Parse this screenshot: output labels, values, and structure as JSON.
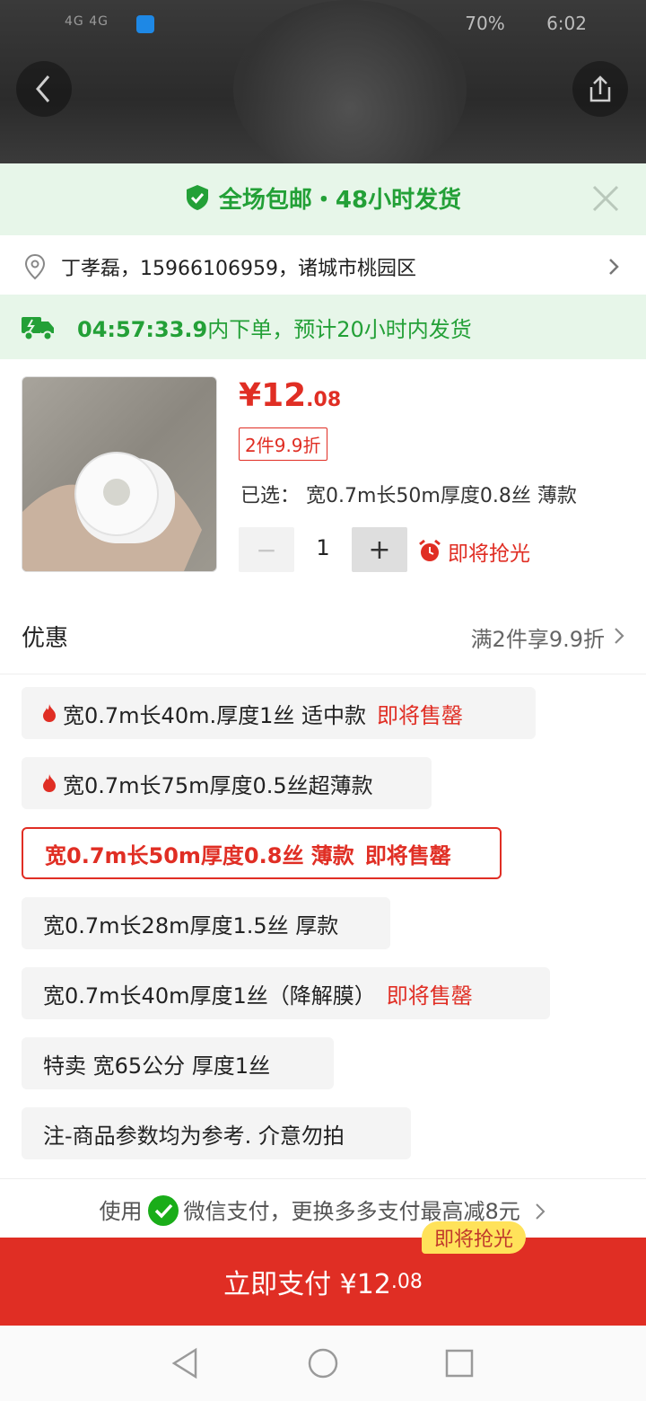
{
  "status_bar": {
    "signal": "4G 4G",
    "battery": "70%",
    "time": "6:02"
  },
  "banner": {
    "text": "全场包邮・48小时发货"
  },
  "address": {
    "text": "丁孝磊，15966106959，诸城市桃园区"
  },
  "shipping": {
    "countdown": "04:57:33.9",
    "text": "内下单，预计20小时内发货"
  },
  "product": {
    "price_symbol": "¥",
    "price_int": "12",
    "price_dec": ".08",
    "discount_tag": "2件9.9折",
    "selected_label": "已选：",
    "selected_value": "宽0.7m长50m厚度0.8丝 薄款",
    "quantity": "1",
    "stock_alert": "即将抢光"
  },
  "promotion": {
    "label": "优惠",
    "value": "满2件享9.9折"
  },
  "skus": [
    {
      "label": "宽0.7m长40m.厚度1丝 适中款",
      "badge": "即将售罄"
    },
    {
      "label": "宽0.7m长75m厚度0.5丝超薄款",
      "badge": ""
    },
    {
      "label": "宽0.7m长50m厚度0.8丝 薄款",
      "badge": "即将售罄"
    },
    {
      "label": "宽0.7m长28m厚度1.5丝 厚款",
      "badge": ""
    },
    {
      "label": "宽0.7m长40m厚度1丝（降解膜）",
      "badge": "即将售罄"
    },
    {
      "label": "特卖  宽65公分  厚度1丝",
      "badge": ""
    },
    {
      "label": "注-商品参数均为参考. 介意勿拍",
      "badge": ""
    }
  ],
  "payment": {
    "prefix": "使用",
    "text": "微信支付，更换多多支付最高减8元",
    "tag": "即将抢光",
    "button_label": "立即支付 ¥12",
    "button_dec": ".08"
  },
  "colors": {
    "accent_red": "#e02e24",
    "accent_green": "#23a037"
  }
}
